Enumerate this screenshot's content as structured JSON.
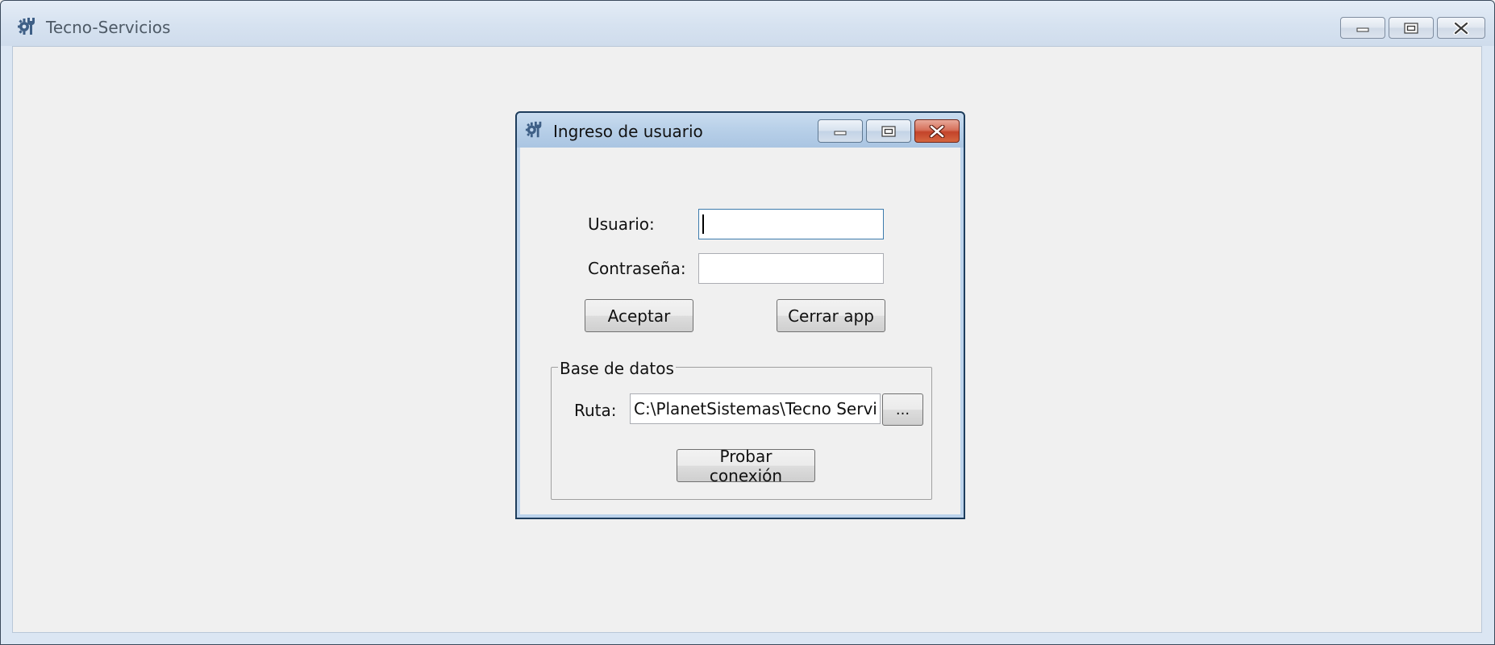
{
  "main_window": {
    "title": "Tecno-Servicios",
    "icon": "wrench-gear-icon"
  },
  "dialog": {
    "title": "Ingreso de usuario",
    "icon": "wrench-gear-icon",
    "usuario_label": "Usuario:",
    "usuario_value": "",
    "contrasena_label": "Contraseña:",
    "contrasena_value": "",
    "aceptar_label": "Aceptar",
    "cerrar_label": "Cerrar app",
    "db_group_label": "Base de datos",
    "ruta_label": "Ruta:",
    "ruta_value": "C:\\PlanetSistemas\\Tecno Servicios",
    "browse_label": "...",
    "probar_label": "Probar conexión"
  },
  "colors": {
    "close_button": "#c3432a",
    "titlebar": "#d6e2f0",
    "client_bg": "#f0f0f0"
  }
}
